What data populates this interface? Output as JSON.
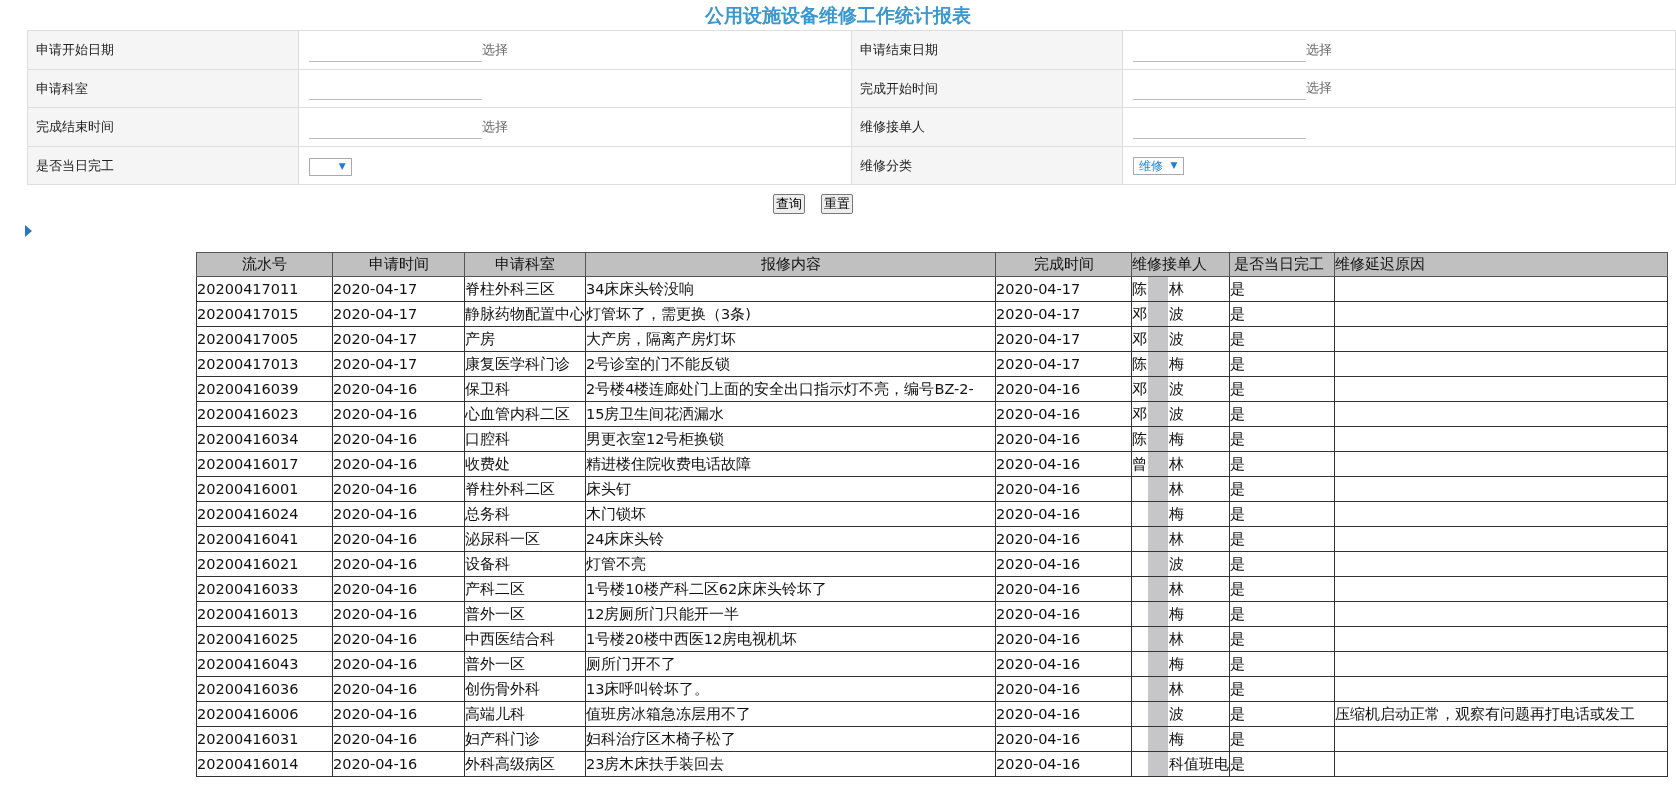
{
  "title": "公用设施设备维修工作统计报表",
  "filters": [
    {
      "label": "申请开始日期",
      "kind": "date",
      "picker": "选择"
    },
    {
      "label": "申请结束日期",
      "kind": "date",
      "picker": "选择"
    },
    {
      "label": "申请科室",
      "kind": "text"
    },
    {
      "label": "完成开始时间",
      "kind": "date",
      "picker": "选择"
    },
    {
      "label": "完成结束时间",
      "kind": "date",
      "picker": "选择"
    },
    {
      "label": "维修接单人",
      "kind": "text"
    },
    {
      "label": "是否当日完工",
      "kind": "select",
      "caret": "▼"
    },
    {
      "label": "维修分类",
      "kind": "select",
      "value": "维修",
      "caret": "▼"
    }
  ],
  "buttons": [
    "查询",
    "重置"
  ],
  "table": {
    "columns": [
      "流水号",
      "申请时间",
      "申请科室",
      "报修内容",
      "完成时间",
      "维修接单人",
      "是否当日完工",
      "维修延迟原因"
    ],
    "rows": [
      {
        "id": "20200417011",
        "date": "2020-04-17",
        "dept": "脊柱外科三区",
        "content": "34床床头铃没响",
        "done": "2020-04-17",
        "handler_first": "陈",
        "handler_last": "林",
        "same_day": "是"
      },
      {
        "id": "20200417015",
        "date": "2020-04-17",
        "dept": "静脉药物配置中心",
        "content": "灯管坏了，需更换（3条)",
        "done": "2020-04-17",
        "handler_first": "邓",
        "handler_last": "波",
        "same_day": "是"
      },
      {
        "id": "20200417005",
        "date": "2020-04-17",
        "dept": "产房",
        "content": "大产房，隔离产房灯坏",
        "done": "2020-04-17",
        "handler_first": "邓",
        "handler_last": "波",
        "same_day": "是"
      },
      {
        "id": "20200417013",
        "date": "2020-04-17",
        "dept": "康复医学科门诊",
        "content": "2号诊室的门不能反锁",
        "done": "2020-04-17",
        "handler_first": "陈",
        "handler_last": "梅",
        "same_day": "是"
      },
      {
        "id": "20200416039",
        "date": "2020-04-16",
        "dept": "保卫科",
        "content": "2号楼4楼连廊处门上面的安全出口指示灯不亮，编号BZ-2-",
        "done": "2020-04-16",
        "handler_first": "邓",
        "handler_last": "波",
        "same_day": "是"
      },
      {
        "id": "20200416023",
        "date": "2020-04-16",
        "dept": "心血管内科二区",
        "content": "15房卫生间花洒漏水",
        "done": "2020-04-16",
        "handler_first": "邓",
        "handler_last": "波",
        "same_day": "是"
      },
      {
        "id": "20200416034",
        "date": "2020-04-16",
        "dept": "口腔科",
        "content": "男更衣室12号柜换锁",
        "done": "2020-04-16",
        "handler_first": "陈",
        "handler_last": "梅",
        "same_day": "是"
      },
      {
        "id": "20200416017",
        "date": "2020-04-16",
        "dept": "收费处",
        "content": "精进楼住院收费电话故障",
        "done": "2020-04-16",
        "handler_first": "曾",
        "handler_last": "林",
        "same_day": "是"
      },
      {
        "id": "20200416001",
        "date": "2020-04-16",
        "dept": "脊柱外科二区",
        "content": "床头钉",
        "done": "2020-04-16",
        "handler_last": "林",
        "same_day": "是"
      },
      {
        "id": "20200416024",
        "date": "2020-04-16",
        "dept": "总务科",
        "content": "木门锁坏",
        "done": "2020-04-16",
        "handler_last": "梅",
        "same_day": "是"
      },
      {
        "id": "20200416041",
        "date": "2020-04-16",
        "dept": "泌尿科一区",
        "content": "24床床头铃",
        "done": "2020-04-16",
        "handler_last": "林",
        "same_day": "是"
      },
      {
        "id": "20200416021",
        "date": "2020-04-16",
        "dept": "设备科",
        "content": "灯管不亮",
        "done": "2020-04-16",
        "handler_last": "波",
        "same_day": "是"
      },
      {
        "id": "20200416033",
        "date": "2020-04-16",
        "dept": "产科二区",
        "content": "1号楼10楼产科二区62床床头铃坏了",
        "done": "2020-04-16",
        "handler_last": "林",
        "same_day": "是"
      },
      {
        "id": "20200416013",
        "date": "2020-04-16",
        "dept": "普外一区",
        "content": "12房厕所门只能开一半",
        "done": "2020-04-16",
        "handler_last": "梅",
        "same_day": "是"
      },
      {
        "id": "20200416025",
        "date": "2020-04-16",
        "dept": "中西医结合科",
        "content": "1号楼20楼中西医12房电视机坏",
        "done": "2020-04-16",
        "handler_last": "林",
        "same_day": "是"
      },
      {
        "id": "20200416043",
        "date": "2020-04-16",
        "dept": "普外一区",
        "content": "厕所门开不了",
        "done": "2020-04-16",
        "handler_last": "梅",
        "same_day": "是"
      },
      {
        "id": "20200416036",
        "date": "2020-04-16",
        "dept": "创伤骨外科",
        "content": "13床呼叫铃坏了。",
        "done": "2020-04-16",
        "handler_last": "林",
        "same_day": "是"
      },
      {
        "id": "20200416006",
        "date": "2020-04-16",
        "dept": "高端儿科",
        "content": "值班房冰箱急冻层用不了",
        "done": "2020-04-16",
        "handler_last": "波",
        "same_day": "是",
        "delay_reason": "压缩机启动正常，观察有问题再打电话或发工"
      },
      {
        "id": "20200416031",
        "date": "2020-04-16",
        "dept": "妇产科门诊",
        "content": "妇科治疗区木椅子松了",
        "done": "2020-04-16",
        "handler_last": "梅",
        "same_day": "是"
      },
      {
        "id": "20200416014",
        "date": "2020-04-16",
        "dept": "外科高级病区",
        "content": "23房木床扶手装回去",
        "done": "2020-04-16",
        "handler_last": "科值班电",
        "same_day": "是"
      }
    ]
  }
}
